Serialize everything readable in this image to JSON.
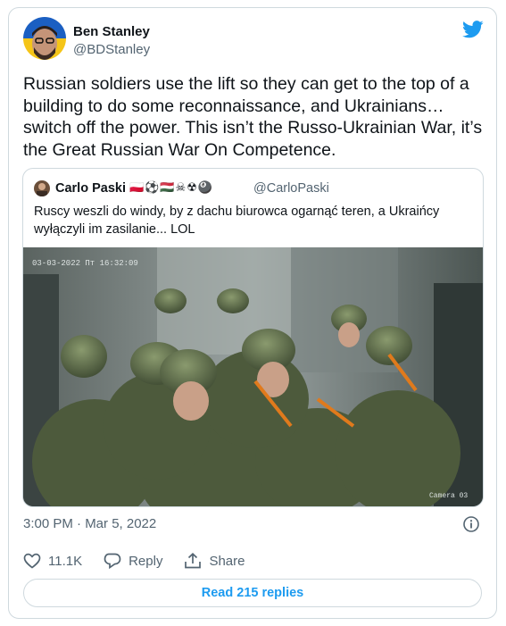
{
  "author": {
    "name": "Ben Stanley",
    "handle": "@BDStanley"
  },
  "tweet_text": "Russian soldiers use the lift so they can get to the top of a building to do some reconnaissance, and Ukrainians… switch off the power. This isn’t the Russo-Ukrainian War, it’s the Great Russian War On Competence.",
  "quoted": {
    "name": "Carlo Paski",
    "emojis": "🇵🇱⚽🇭🇺☠☢🎱",
    "handle": "@CarloPaski",
    "text": "Ruscy weszli do windy, by z dachu biurowca ogarnąć teren, a Ukraińcy wyłączyli im zasilanie... LOL",
    "media": {
      "timestamp": "03-03-2022 Пт 16:32:09",
      "camera_label": "Camera 03"
    }
  },
  "timestamp": "3:00 PM · Mar 5, 2022",
  "actions": {
    "likes": "11.1K",
    "reply_label": "Reply",
    "share_label": "Share"
  },
  "read_replies": "Read 215 replies",
  "colors": {
    "accent": "#1d9bf0",
    "secondary_text": "#536471",
    "border": "#cfd9de"
  }
}
